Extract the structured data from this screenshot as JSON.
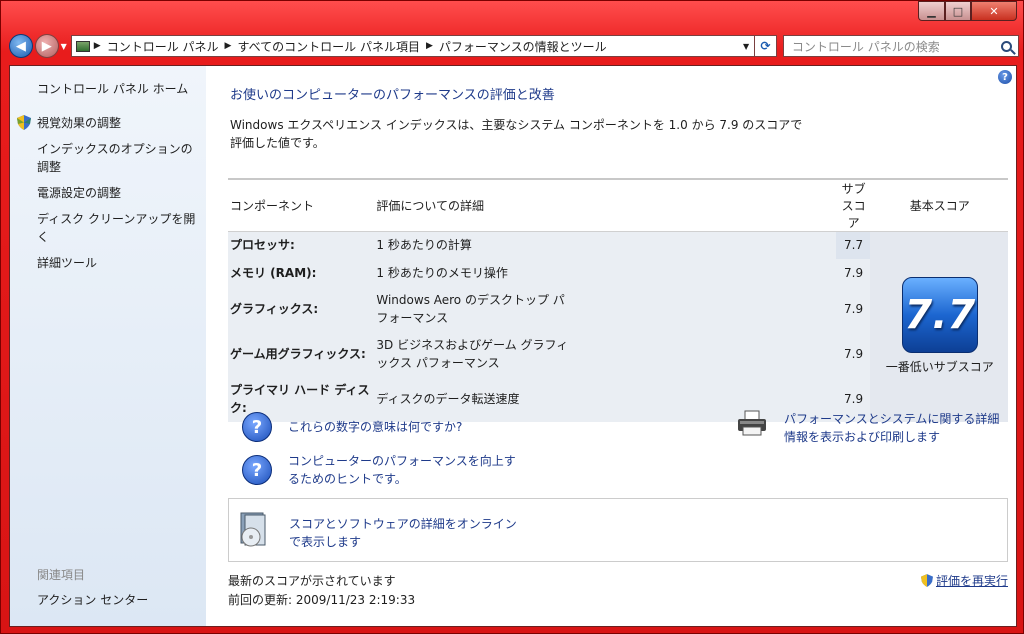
{
  "address": {
    "crumbs": [
      "コントロール パネル",
      "すべてのコントロール パネル項目",
      "パフォーマンスの情報とツール"
    ]
  },
  "search": {
    "placeholder": "コントロール パネルの検索"
  },
  "sidebar": {
    "home": "コントロール パネル ホーム",
    "items": [
      {
        "label": "視覚効果の調整"
      },
      {
        "label": "インデックスのオプションの調整"
      },
      {
        "label": "電源設定の調整"
      },
      {
        "label": "ディスク クリーンアップを開く"
      },
      {
        "label": "詳細ツール"
      }
    ],
    "related_heading": "関連項目",
    "related_item": "アクション センター"
  },
  "main": {
    "title": "お使いのコンピューターのパフォーマンスの評価と改善",
    "description": "Windows エクスペリエンス インデックスは、主要なシステム コンポーネントを 1.0 から 7.9 のスコアで評価した値です。",
    "columns": {
      "component": "コンポーネント",
      "detail": "評価についての詳細",
      "subscore": "サブスコア",
      "basescore": "基本スコア"
    },
    "rows": [
      {
        "component": "プロセッサ:",
        "detail": "1 秒あたりの計算",
        "subscore": "7.7"
      },
      {
        "component": "メモリ (RAM):",
        "detail": "1 秒あたりのメモリ操作",
        "subscore": "7.9"
      },
      {
        "component": "グラフィックス:",
        "detail": "Windows Aero のデスクトップ パフォーマンス",
        "subscore": "7.9"
      },
      {
        "component": "ゲーム用グラフィックス:",
        "detail": "3D ビジネスおよびゲーム グラフィックス パフォーマンス",
        "subscore": "7.9"
      },
      {
        "component": "プライマリ ハード ディスク:",
        "detail": "ディスクのデータ転送速度",
        "subscore": "7.9"
      }
    ],
    "base_score": "7.7",
    "base_score_label": "一番低いサブスコア",
    "links": {
      "meaning": "これらの数字の意味は何ですか?",
      "tips": "コンピューターのパフォーマンスを向上するためのヒントです。",
      "print": "パフォーマンスとシステムに関する詳細情報を表示および印刷します",
      "online": "スコアとソフトウェアの詳細をオンラインで表示します"
    },
    "status": "最新のスコアが示されています",
    "last_update": "前回の更新: 2009/11/23 2:19:33",
    "rerun": "評価を再実行"
  }
}
